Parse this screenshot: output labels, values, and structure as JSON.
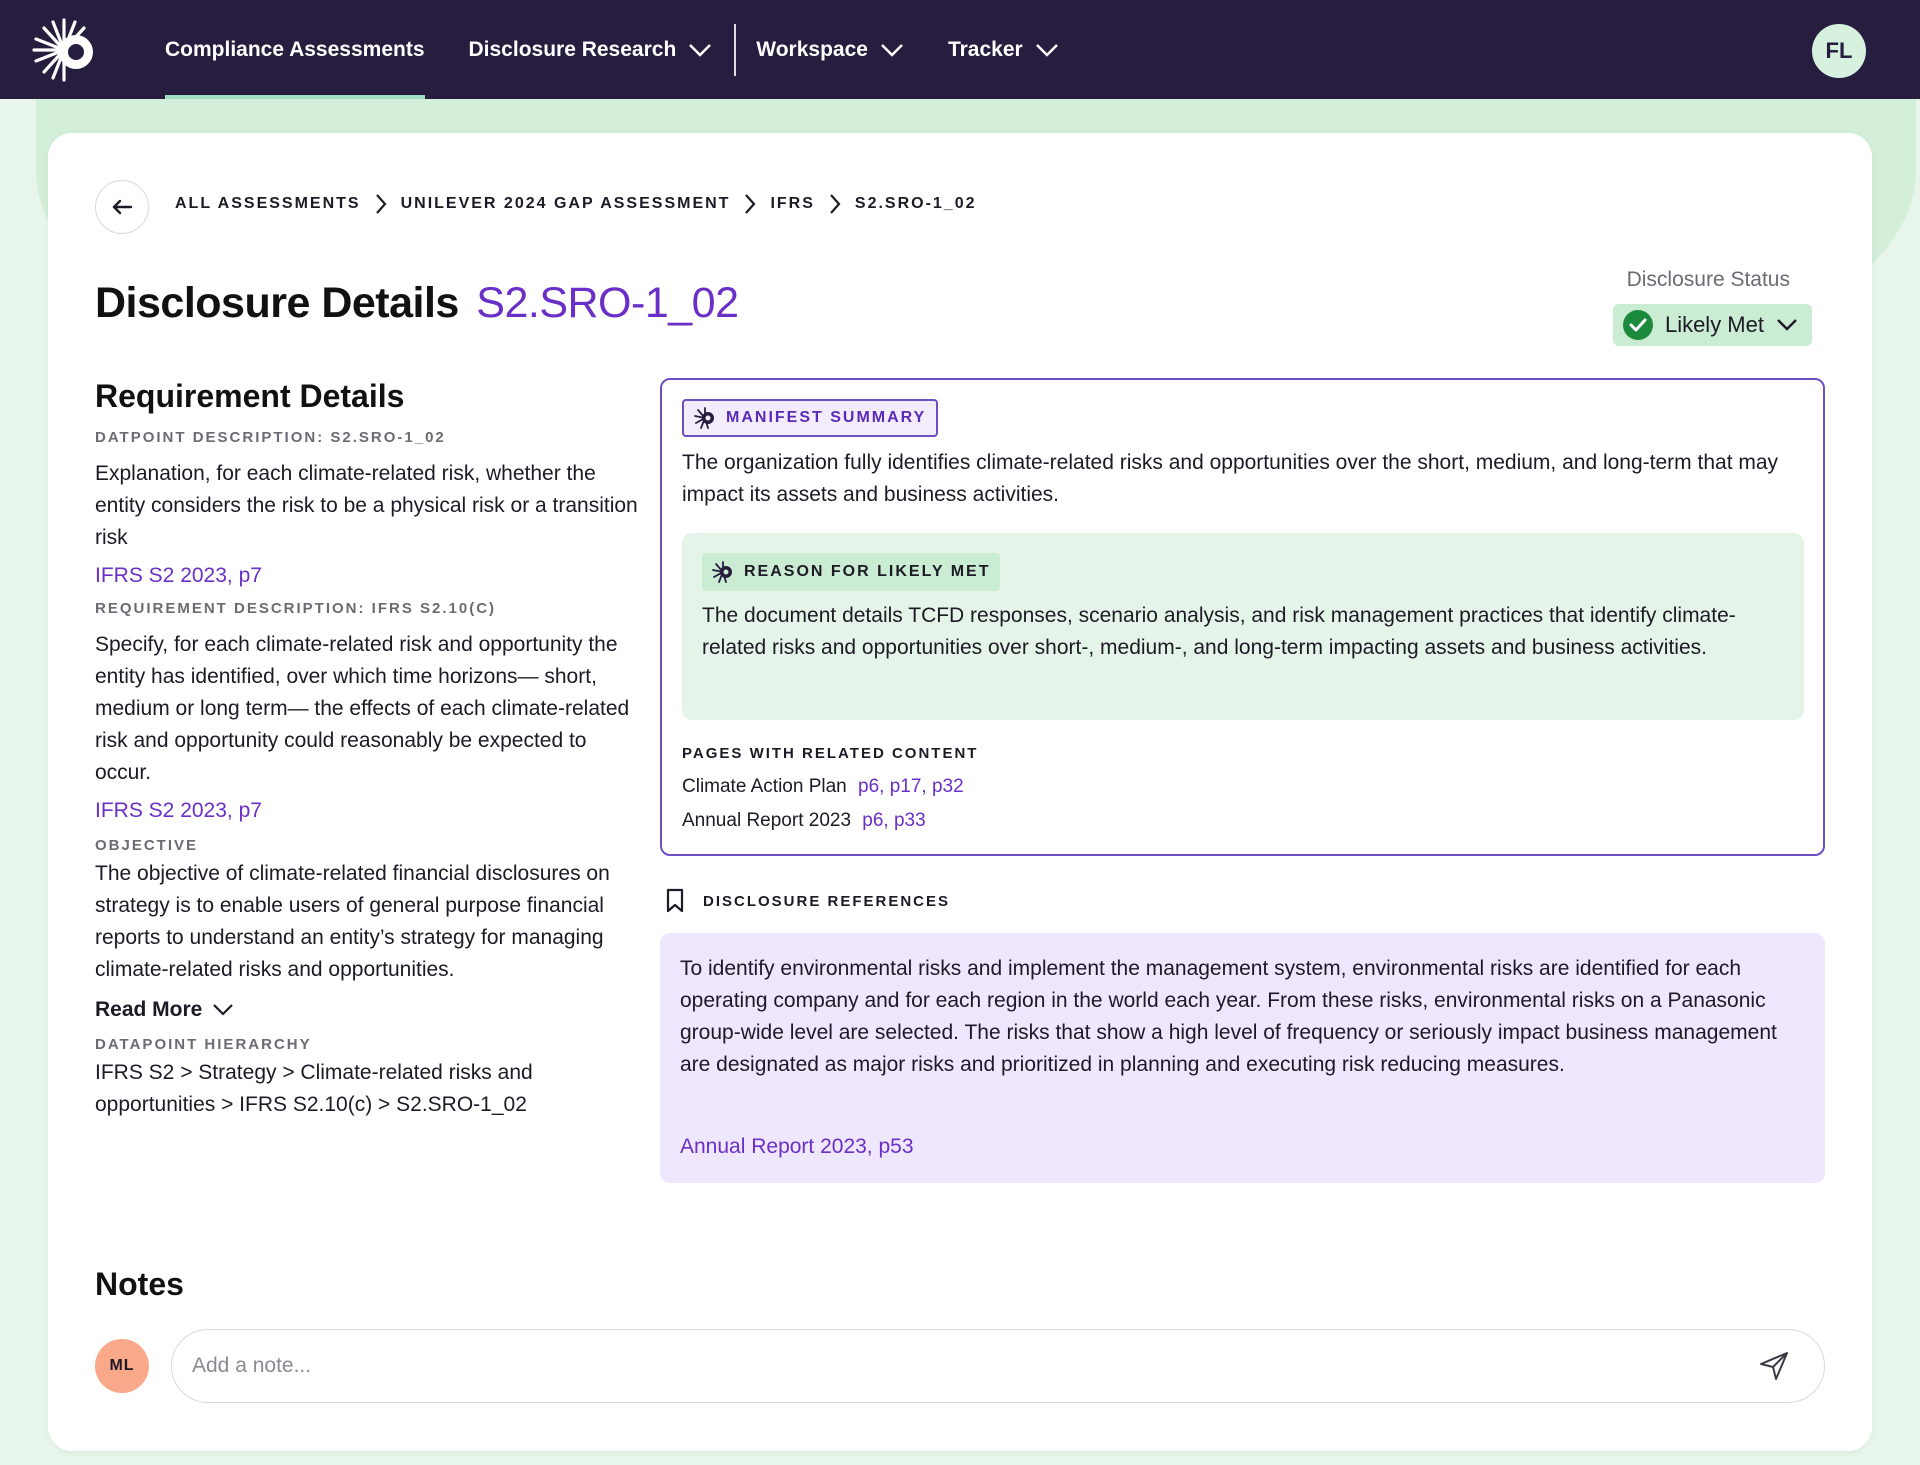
{
  "nav": {
    "items": [
      {
        "label": "Compliance Assessments",
        "active": true
      },
      {
        "label": "Disclosure Research",
        "active": false
      },
      {
        "label": "Workspace",
        "active": false
      },
      {
        "label": "Tracker",
        "active": false
      }
    ],
    "user_initials": "FL"
  },
  "breadcrumb": [
    "ALL ASSESSMENTS",
    "UNILEVER 2024 GAP ASSESSMENT",
    "IFRS",
    "S2.SRO-1_02"
  ],
  "page": {
    "title": "Disclosure Details",
    "code": "S2.SRO-1_02",
    "status_label": "Disclosure Status",
    "status_value": "Likely Met"
  },
  "requirement": {
    "title": "Requirement Details",
    "datapoint_label": "DATPOINT DESCRIPTION: S2.SRO-1_02",
    "datapoint_text": "Explanation, for each climate-related risk, whether the entity considers the risk to be a physical risk or a transition risk",
    "datapoint_link": "IFRS S2 2023, p7",
    "requirement_label": "REQUIREMENT DESCRIPTION: IFRS S2.10(C)",
    "requirement_text": "Specify, for each climate-related risk and opportunity the entity has identified, over which time horizons— short, medium or long term— the effects of each climate-related risk and opportunity could reasonably be expected to occur.",
    "requirement_link": "IFRS S2 2023, p7",
    "objective_label": "OBJECTIVE",
    "objective_text": "The objective of climate-related financial disclosures on strategy is to enable users of general purpose financial reports to understand an entity’s strategy for managing climate-related risks and opportunities.",
    "read_more": "Read More",
    "hierarchy_label": "DATAPOINT HIERARCHY",
    "hierarchy_text": "IFRS S2 > Strategy > Climate-related risks and opportunities > IFRS S2.10(c) > S2.SRO-1_02"
  },
  "summary": {
    "badge": "MANIFEST SUMMARY",
    "text": "The organization fully identifies climate-related risks and opportunities over the short, medium, and long-term that may impact its assets and business activities.",
    "reason_badge": "REASON FOR LIKELY MET",
    "reason_text": "The document details TCFD responses, scenario analysis, and risk management practices that identify climate-related risks and opportunities over short-, medium-, and long-term impacting assets and business activities.",
    "pages_label": "PAGES WITH RELATED CONTENT",
    "pages": [
      {
        "doc": "Climate Action Plan",
        "links": "p6, p17, p32"
      },
      {
        "doc": "Annual Report 2023",
        "links": "p6, p33"
      }
    ]
  },
  "references": {
    "label": "DISCLOSURE REFERENCES",
    "text": "To identify environmental risks and implement the management system, environmental risks are identified for each operating company and for each region in the world each year. From these risks, environmental risks on a Panasonic group-wide level are selected. The risks that show a high level of frequency or seriously impact business management are designated as major risks and prioritized in planning and executing risk reducing measures.",
    "link": "Annual Report 2023, p53"
  },
  "notes": {
    "title": "Notes",
    "user_initials": "ML",
    "placeholder": "Add a note..."
  },
  "colors": {
    "nav_bg": "#261d3f",
    "accent_purple": "#6a2fc7",
    "status_green": "#1b8a3d",
    "mint_bg": "#e8f5ea"
  }
}
